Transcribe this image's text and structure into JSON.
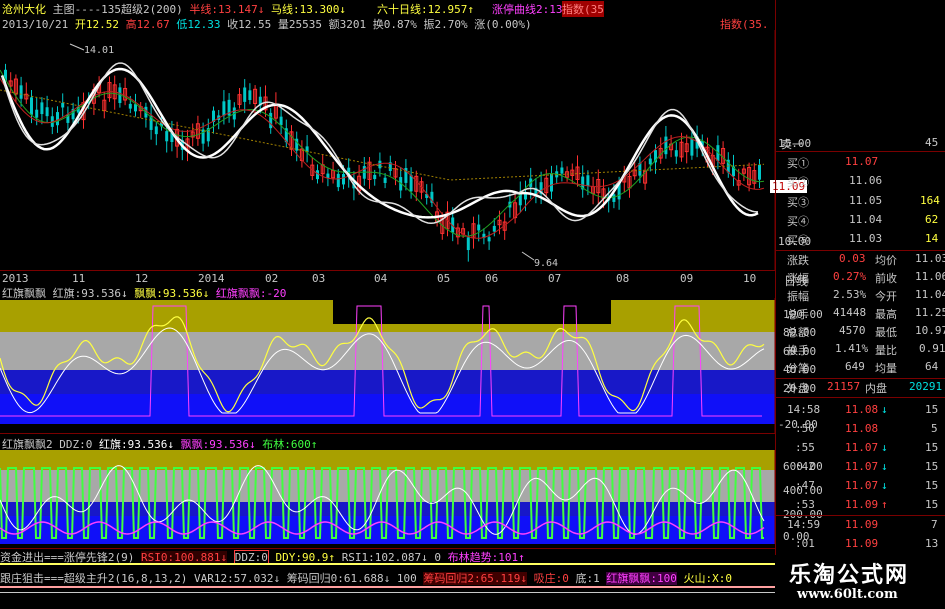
{
  "header": {
    "line1": {
      "stock": "沧州大化",
      "chart": "主图----135超级2(200)",
      "ma1": "半线:13.147↓",
      "ma2": "马线:13.300↓",
      "ma3": "六十日线:12.957↑",
      "ma4": "涨停曲线2:13.05",
      "ind": "指数(35"
    },
    "line2": {
      "date": "2013/10/21",
      "open": "开12.52",
      "high": "高12.67",
      "low": "低12.33",
      "close": "收12.55",
      "vol": "量25535",
      "amt": "额3201",
      "turn": "换0.87%",
      "amp": "振2.70%",
      "chg": "涨(0.00%)",
      "idx": "指数(35."
    }
  },
  "main_chart": {
    "price_top_label": "14.01",
    "price_low_label": "9.64",
    "last_price": "11.09",
    "axis_right": [
      "15.00",
      "10.00"
    ],
    "xaxis": [
      "2013",
      "11",
      "12",
      "2014",
      "02",
      "03",
      "04",
      "05",
      "06",
      "07",
      "08",
      "09",
      "10"
    ],
    "axis_unit": "日线"
  },
  "panel1": {
    "name": "红旗飘飘",
    "v1": "红旗:93.536↓",
    "v2": "飘飘:93.536↓",
    "v3": "红旗飘飘:-20",
    "axis": [
      "100.00",
      "80.00",
      "60.00",
      "40.00",
      "20.00",
      "-20.00"
    ]
  },
  "panel2": {
    "name": "红旗飘飘2",
    "v1": "DDZ:0",
    "v2": "红旗:93.536↓",
    "v3": "飘飘:93.536↓",
    "v4": "布林:600↑",
    "axis": [
      "600.00",
      "400.00",
      "200.00",
      "0.00"
    ]
  },
  "bottom_bar1": {
    "a": "资金进出===涨停先锋2(9)",
    "b": "RSI0:100.881↓",
    "c": "DDZ:0",
    "d": "DDY:90.9↑",
    "e": "RSI1:102.087↓",
    "f": "0",
    "g": "布林趋势:101↑"
  },
  "bottom_bar2": {
    "a": "跟庄狙击===超级主升2(16,8,13,2)",
    "b": "VAR12:57.032↓",
    "c": "筹码回归0:61.688↓",
    "d": "100",
    "e": "筹码回归2:65.119↓",
    "f": "吸庄:0",
    "g": "底:1",
    "h": "红旗飘飘:100",
    "i": "火山:X:0"
  },
  "order_book": {
    "header_left": "卖一",
    "header_right": "45",
    "bids": [
      {
        "label": "买①",
        "price": "11.07",
        "vol": ""
      },
      {
        "label": "买②",
        "price": "11.06",
        "vol": ""
      },
      {
        "label": "买③",
        "price": "11.05",
        "vol": "164"
      },
      {
        "label": "买④",
        "price": "11.04",
        "vol": "62"
      },
      {
        "label": "买⑤",
        "price": "11.03",
        "vol": "14"
      }
    ]
  },
  "stats": [
    {
      "l1": "涨跌",
      "v1": "0.03",
      "l2": "均价",
      "v2": "11.03"
    },
    {
      "l1": "涨幅",
      "v1": "0.27%",
      "l2": "前收",
      "v2": "11.06"
    },
    {
      "l1": "振幅",
      "v1": "2.53%",
      "l2": "今开",
      "v2": "11.04"
    },
    {
      "l1": "总手",
      "v1": "41448",
      "l2": "最高",
      "v2": "11.25"
    },
    {
      "l1": "总额",
      "v1": "4570",
      "l2": "最低",
      "v2": "10.97"
    },
    {
      "l1": "换手",
      "v1": "1.41%",
      "l2": "量比",
      "v2": "0.91"
    },
    {
      "l1": "分笔",
      "v1": "649",
      "l2": "均量",
      "v2": "64"
    }
  ],
  "inout": {
    "outer_label": "外盘",
    "outer": "21157",
    "inner_label": "内盘",
    "inner": "20291"
  },
  "ticks": [
    {
      "t": "14:58",
      "p": "11.08",
      "a": "↓",
      "v": "15"
    },
    {
      "t": ":50",
      "p": "11.08",
      "a": "",
      "v": "5"
    },
    {
      "t": ":55",
      "p": "11.07",
      "a": "↓",
      "v": "15"
    },
    {
      "t": ":42",
      "p": "11.07",
      "a": "↓",
      "v": "15"
    },
    {
      "t": ":47",
      "p": "11.07",
      "a": "↓",
      "v": "15"
    },
    {
      "t": ":53",
      "p": "11.09",
      "a": "↑",
      "v": "15"
    },
    {
      "t": "14:59",
      "p": "11.09",
      "a": "",
      "v": "7"
    },
    {
      "t": ":01",
      "p": "11.09",
      "a": "",
      "v": "13"
    }
  ],
  "brand": {
    "name": "乐淘公式网",
    "url": "www.60lt.com"
  },
  "colors": {
    "up": "#ff3030",
    "down": "#00c8c8",
    "yellow": "#ffff40",
    "olive": "#a8a000",
    "blue": "#1010f0",
    "gray": "#a8a8a8",
    "green": "#40ff40",
    "magenta": "#ff40ff"
  }
}
